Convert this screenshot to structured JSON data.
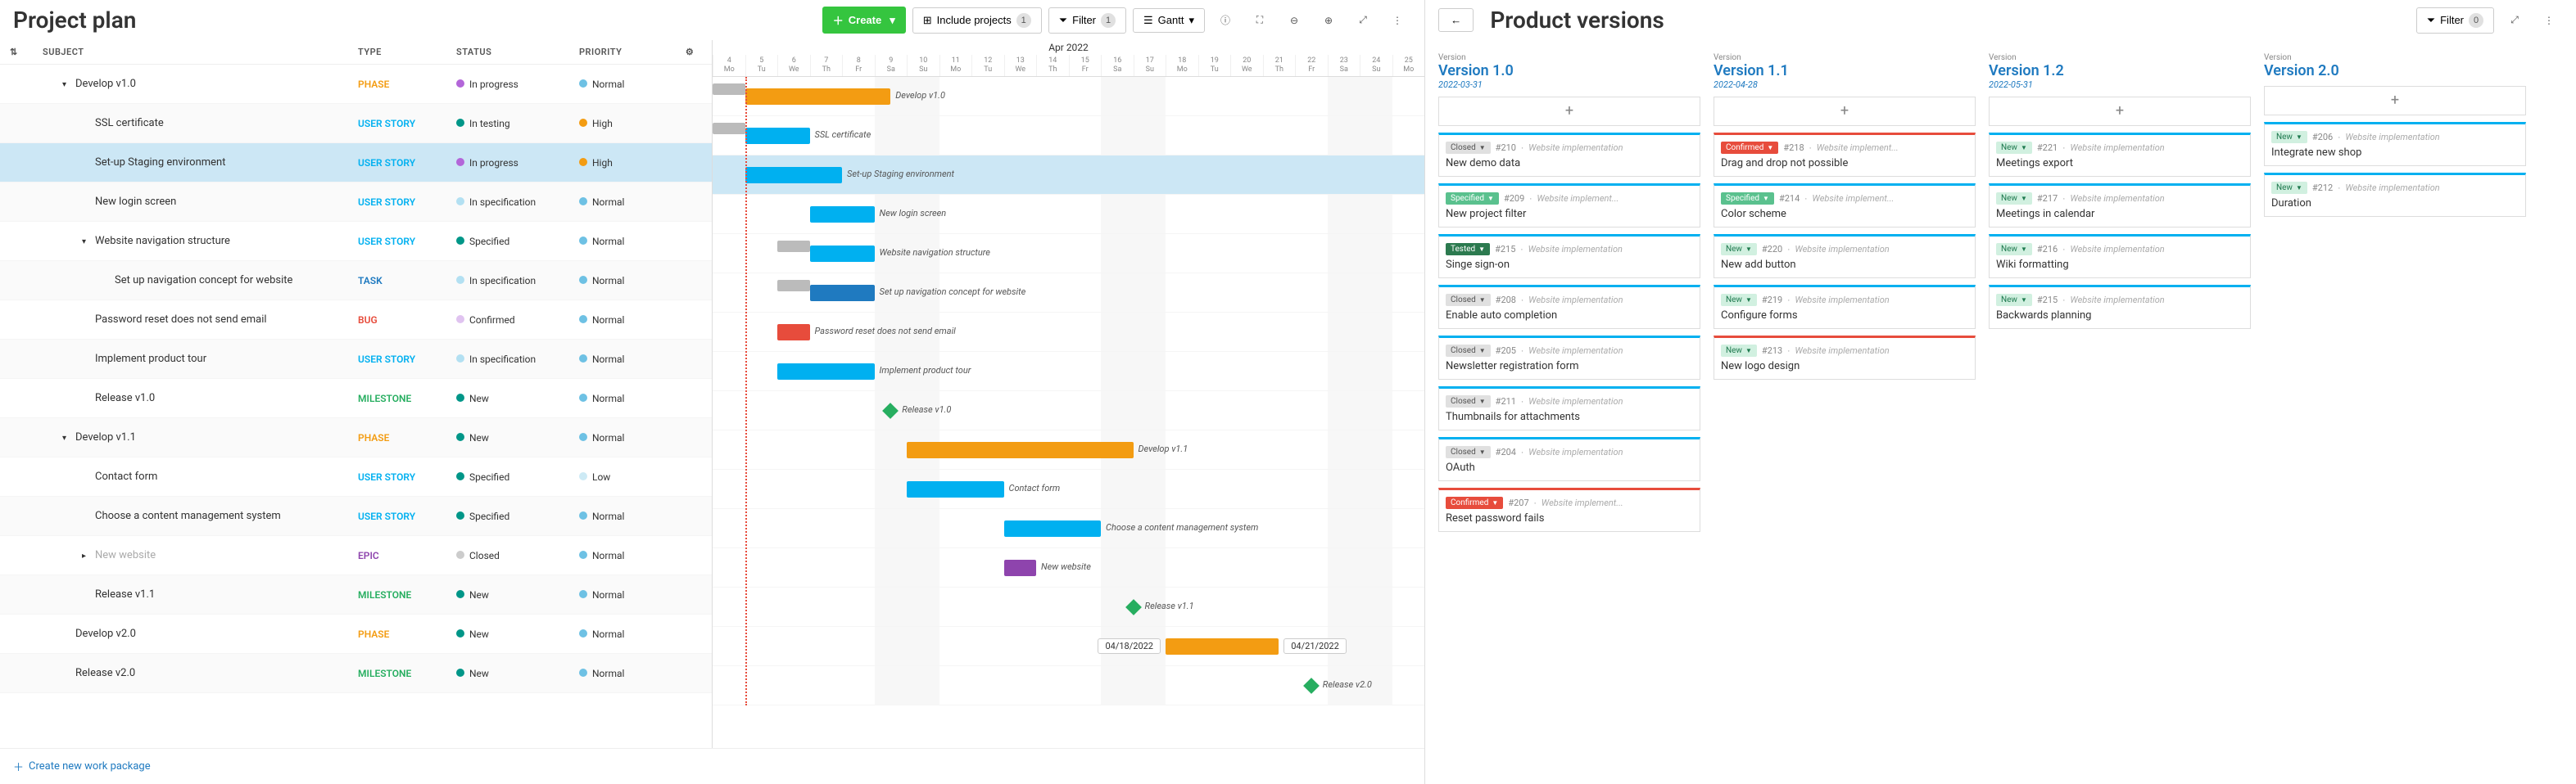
{
  "leftPanel": {
    "title": "Project plan",
    "toolbar": {
      "create": "Create",
      "includeProjects": "Include projects",
      "includeCount": "1",
      "filter": "Filter",
      "filterCount": "1",
      "gantt": "Gantt"
    },
    "columns": {
      "subject": "SUBJECT",
      "type": "TYPE",
      "status": "STATUS",
      "priority": "PRIORITY"
    },
    "rows": [
      {
        "subject": "Develop v1.0",
        "indent": 1,
        "expand": "down",
        "type": "PHASE",
        "typeClass": "type-phase",
        "status": "In progress",
        "statusColor": "#b366d9",
        "priority": "Normal",
        "priorityColor": "#6ec1e4"
      },
      {
        "subject": "SSL certificate",
        "indent": 2,
        "type": "USER STORY",
        "typeClass": "type-userstory",
        "status": "In testing",
        "statusColor": "#009688",
        "priority": "High",
        "priorityColor": "#f39c12"
      },
      {
        "subject": "Set-up Staging environment",
        "indent": 2,
        "type": "USER STORY",
        "typeClass": "type-userstory",
        "status": "In progress",
        "statusColor": "#b366d9",
        "priority": "High",
        "priorityColor": "#f39c12",
        "selected": true
      },
      {
        "subject": "New login screen",
        "indent": 2,
        "type": "USER STORY",
        "typeClass": "type-userstory",
        "status": "In specification",
        "statusColor": "#b3e0f2",
        "priority": "Normal",
        "priorityColor": "#6ec1e4"
      },
      {
        "subject": "Website navigation structure",
        "indent": 2,
        "expand": "down",
        "type": "USER STORY",
        "typeClass": "type-userstory",
        "status": "Specified",
        "statusColor": "#009688",
        "priority": "Normal",
        "priorityColor": "#6ec1e4"
      },
      {
        "subject": "Set up navigation concept for website",
        "indent": 3,
        "type": "TASK",
        "typeClass": "type-task",
        "status": "In specification",
        "statusColor": "#b3e0f2",
        "priority": "Normal",
        "priorityColor": "#6ec1e4"
      },
      {
        "subject": "Password reset does not send email",
        "indent": 2,
        "type": "BUG",
        "typeClass": "type-bug",
        "status": "Confirmed",
        "statusColor": "#e0c3f0",
        "priority": "Normal",
        "priorityColor": "#6ec1e4"
      },
      {
        "subject": "Implement product tour",
        "indent": 2,
        "type": "USER STORY",
        "typeClass": "type-userstory",
        "status": "In specification",
        "statusColor": "#b3e0f2",
        "priority": "Normal",
        "priorityColor": "#6ec1e4"
      },
      {
        "subject": "Release v1.0",
        "indent": 2,
        "type": "MILESTONE",
        "typeClass": "type-milestone",
        "status": "New",
        "statusColor": "#009688",
        "priority": "Normal",
        "priorityColor": "#6ec1e4"
      },
      {
        "subject": "Develop v1.1",
        "indent": 1,
        "expand": "down",
        "type": "PHASE",
        "typeClass": "type-phase",
        "status": "New",
        "statusColor": "#009688",
        "priority": "Normal",
        "priorityColor": "#6ec1e4"
      },
      {
        "subject": "Contact form",
        "indent": 2,
        "type": "USER STORY",
        "typeClass": "type-userstory",
        "status": "Specified",
        "statusColor": "#009688",
        "priority": "Low",
        "priorityColor": "#cdeaf5"
      },
      {
        "subject": "Choose a content management system",
        "indent": 2,
        "type": "USER STORY",
        "typeClass": "type-userstory",
        "status": "Specified",
        "statusColor": "#009688",
        "priority": "Normal",
        "priorityColor": "#6ec1e4"
      },
      {
        "subject": "New website",
        "indent": 2,
        "expand": "right",
        "muted": true,
        "type": "EPIC",
        "typeClass": "type-epic",
        "status": "Closed",
        "statusColor": "#ccc",
        "priority": "Normal",
        "priorityColor": "#6ec1e4"
      },
      {
        "subject": "Release v1.1",
        "indent": 2,
        "type": "MILESTONE",
        "typeClass": "type-milestone",
        "status": "New",
        "statusColor": "#009688",
        "priority": "Normal",
        "priorityColor": "#6ec1e4"
      },
      {
        "subject": "Develop v2.0",
        "indent": 1,
        "type": "PHASE",
        "typeClass": "type-phase",
        "status": "New",
        "statusColor": "#009688",
        "priority": "Normal",
        "priorityColor": "#6ec1e4"
      },
      {
        "subject": "Release v2.0",
        "indent": 1,
        "type": "MILESTONE",
        "typeClass": "type-milestone",
        "status": "New",
        "statusColor": "#009688",
        "priority": "Normal",
        "priorityColor": "#6ec1e4"
      }
    ],
    "createLink": "Create new work package",
    "gantt": {
      "month": "Apr 2022",
      "days": [
        {
          "n": "4",
          "d": "Mo"
        },
        {
          "n": "5",
          "d": "Tu"
        },
        {
          "n": "6",
          "d": "We"
        },
        {
          "n": "7",
          "d": "Th"
        },
        {
          "n": "8",
          "d": "Fr"
        },
        {
          "n": "9",
          "d": "Sa"
        },
        {
          "n": "10",
          "d": "Su"
        },
        {
          "n": "11",
          "d": "Mo"
        },
        {
          "n": "12",
          "d": "Tu"
        },
        {
          "n": "13",
          "d": "We"
        },
        {
          "n": "14",
          "d": "Th"
        },
        {
          "n": "15",
          "d": "Fr"
        },
        {
          "n": "16",
          "d": "Sa"
        },
        {
          "n": "17",
          "d": "Su"
        },
        {
          "n": "18",
          "d": "Mo"
        },
        {
          "n": "19",
          "d": "Tu"
        },
        {
          "n": "20",
          "d": "We"
        },
        {
          "n": "21",
          "d": "Th"
        },
        {
          "n": "22",
          "d": "Fr"
        },
        {
          "n": "23",
          "d": "Sa"
        },
        {
          "n": "24",
          "d": "Su"
        },
        {
          "n": "25",
          "d": "Mo"
        }
      ],
      "todayIndex": 1,
      "bars": [
        {
          "row": 0,
          "type": "phase",
          "start": 1,
          "end": 5.5,
          "label": "Develop v1.0",
          "gray": {
            "start": 0,
            "end": 1
          }
        },
        {
          "row": 1,
          "type": "userstory",
          "start": 1,
          "end": 3,
          "label": "SSL certificate",
          "gray": {
            "start": 0,
            "end": 1
          }
        },
        {
          "row": 2,
          "type": "userstory",
          "start": 1,
          "end": 4,
          "label": "Set-up Staging environment",
          "selected": true
        },
        {
          "row": 3,
          "type": "userstory",
          "start": 3,
          "end": 5,
          "label": "New login screen"
        },
        {
          "row": 4,
          "type": "userstory",
          "start": 3,
          "end": 5,
          "label": "Website navigation structure",
          "gray": {
            "start": 2,
            "end": 3
          }
        },
        {
          "row": 5,
          "type": "task",
          "start": 3,
          "end": 5,
          "label": "Set up navigation concept for website",
          "gray": {
            "start": 2,
            "end": 3
          }
        },
        {
          "row": 6,
          "type": "bug",
          "start": 2,
          "end": 3,
          "label": "Password reset does not send email"
        },
        {
          "row": 7,
          "type": "userstory",
          "start": 2,
          "end": 5,
          "label": "Implement product tour"
        },
        {
          "row": 8,
          "diamond": true,
          "pos": 5.5,
          "label": "Release v1.0"
        },
        {
          "row": 9,
          "type": "phase",
          "start": 6,
          "end": 13,
          "label": "Develop v1.1"
        },
        {
          "row": 10,
          "type": "userstory",
          "start": 6,
          "end": 9,
          "label": "Contact form"
        },
        {
          "row": 11,
          "type": "userstory",
          "start": 9,
          "end": 12,
          "label": "Choose a content management system"
        },
        {
          "row": 12,
          "type": "epic",
          "start": 9,
          "end": 10,
          "label": "New website"
        },
        {
          "row": 13,
          "diamond": true,
          "pos": 13,
          "label": "Release v1.1"
        },
        {
          "row": 14,
          "type": "phase",
          "start": 14,
          "end": 17.5,
          "dateStart": "04/18/2022",
          "dateEnd": "04/21/2022"
        },
        {
          "row": 15,
          "diamond": true,
          "pos": 18.5,
          "label": "Release v2.0"
        }
      ]
    }
  },
  "rightPanel": {
    "title": "Product versions",
    "filter": "Filter",
    "filterCount": "0",
    "columns": [
      {
        "name": "Version 1.0",
        "date": "2022-03-31",
        "cards": [
          {
            "status": "Closed",
            "statusClass": "status-closed",
            "id": "#210",
            "proj": "Website implementation",
            "title": "New demo data",
            "border": "border-blue"
          },
          {
            "status": "Specified",
            "statusClass": "status-specified",
            "id": "#209",
            "proj": "Website implement...",
            "title": "New project filter",
            "border": "border-blue"
          },
          {
            "status": "Tested",
            "statusClass": "status-tested",
            "id": "#215",
            "proj": "Website implementation",
            "title": "Singe sign-on",
            "border": "border-blue"
          },
          {
            "status": "Closed",
            "statusClass": "status-closed",
            "id": "#208",
            "proj": "Website implementation",
            "title": "Enable auto completion",
            "border": "border-blue"
          },
          {
            "status": "Closed",
            "statusClass": "status-closed",
            "id": "#205",
            "proj": "Website implementation",
            "title": "Newsletter registration form",
            "border": "border-blue"
          },
          {
            "status": "Closed",
            "statusClass": "status-closed",
            "id": "#211",
            "proj": "Website implementation",
            "title": "Thumbnails for attachments",
            "border": "border-blue"
          },
          {
            "status": "Closed",
            "statusClass": "status-closed",
            "id": "#204",
            "proj": "Website implementation",
            "title": "OAuth",
            "border": "border-blue"
          },
          {
            "status": "Confirmed",
            "statusClass": "status-confirmed",
            "id": "#207",
            "proj": "Website implement...",
            "title": "Reset password fails",
            "border": "border-red"
          }
        ]
      },
      {
        "name": "Version 1.1",
        "date": "2022-04-28",
        "cards": [
          {
            "status": "Confirmed",
            "statusClass": "status-confirmed",
            "id": "#218",
            "proj": "Website implement...",
            "title": "Drag and drop not possible",
            "border": "border-red"
          },
          {
            "status": "Specified",
            "statusClass": "status-specified",
            "id": "#214",
            "proj": "Website implement...",
            "title": "Color scheme",
            "border": "border-blue"
          },
          {
            "status": "New",
            "statusClass": "status-new",
            "id": "#220",
            "proj": "Website implementation",
            "title": "New add button",
            "border": "border-blue"
          },
          {
            "status": "New",
            "statusClass": "status-new",
            "id": "#219",
            "proj": "Website implementation",
            "title": "Configure forms",
            "border": "border-blue"
          },
          {
            "status": "New",
            "statusClass": "status-new",
            "id": "#213",
            "proj": "Website implementation",
            "title": "New logo design",
            "border": "border-red"
          }
        ]
      },
      {
        "name": "Version 1.2",
        "date": "2022-05-31",
        "cards": [
          {
            "status": "New",
            "statusClass": "status-new",
            "id": "#221",
            "proj": "Website implementation",
            "title": "Meetings export",
            "border": "border-blue"
          },
          {
            "status": "New",
            "statusClass": "status-new",
            "id": "#217",
            "proj": "Website implementation",
            "title": "Meetings in calendar",
            "border": "border-blue"
          },
          {
            "status": "New",
            "statusClass": "status-new",
            "id": "#216",
            "proj": "Website implementation",
            "title": "Wiki formatting",
            "border": "border-blue"
          },
          {
            "status": "New",
            "statusClass": "status-new",
            "id": "#215",
            "proj": "Website implementation",
            "title": "Backwards planning",
            "border": "border-blue"
          }
        ]
      },
      {
        "name": "Version 2.0",
        "date": "",
        "cards": [
          {
            "status": "New",
            "statusClass": "status-new",
            "id": "#206",
            "proj": "Website implementation",
            "title": "Integrate new shop",
            "border": "border-blue"
          },
          {
            "status": "New",
            "statusClass": "status-new",
            "id": "#212",
            "proj": "Website implementation",
            "title": "Duration",
            "border": "border-blue"
          }
        ]
      }
    ]
  }
}
